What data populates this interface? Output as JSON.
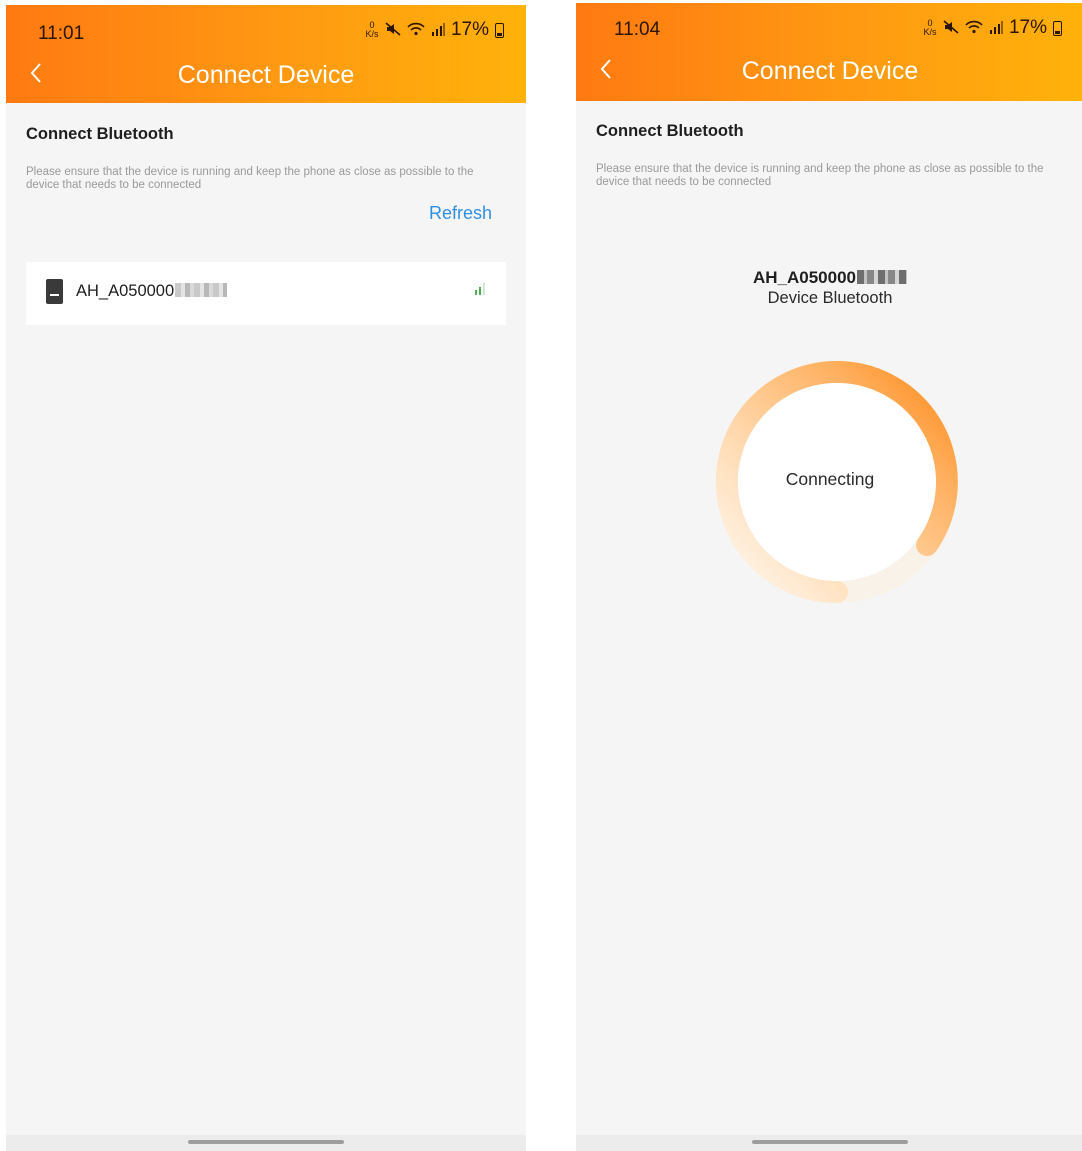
{
  "left_screen": {
    "status": {
      "time": "11:01",
      "net_speed_top": "0",
      "net_speed_unit": "K/s",
      "battery": "17%"
    },
    "header": {
      "title": "Connect Device",
      "back_icon": "chevron-left-icon"
    },
    "section": {
      "title": "Connect Bluetooth",
      "description": "Please ensure that the device is running and keep the phone as close as possible to the device that needs to be connected"
    },
    "refresh_label": "Refresh",
    "devices": [
      {
        "name": "AH_A050000",
        "icon": "device-icon",
        "signal_icon": "signal-strength-icon"
      }
    ]
  },
  "right_screen": {
    "status": {
      "time": "11:04",
      "net_speed_top": "0",
      "net_speed_unit": "K/s",
      "battery": "17%"
    },
    "header": {
      "title": "Connect Device",
      "back_icon": "chevron-left-icon"
    },
    "section": {
      "title": "Connect Bluetooth",
      "description": "Please ensure that the device is running and keep the phone as close as possible to the device that needs to be connected"
    },
    "device_name": "AH_A050000",
    "device_subtitle": "Device Bluetooth",
    "connecting_label": "Connecting"
  },
  "colors": {
    "header_gradient_start": "#ff7a12",
    "header_gradient_end": "#ffb20a",
    "refresh_link": "#2f8fe5",
    "signal_green": "#4caf50",
    "ring_orange": "#ff8a1a"
  }
}
